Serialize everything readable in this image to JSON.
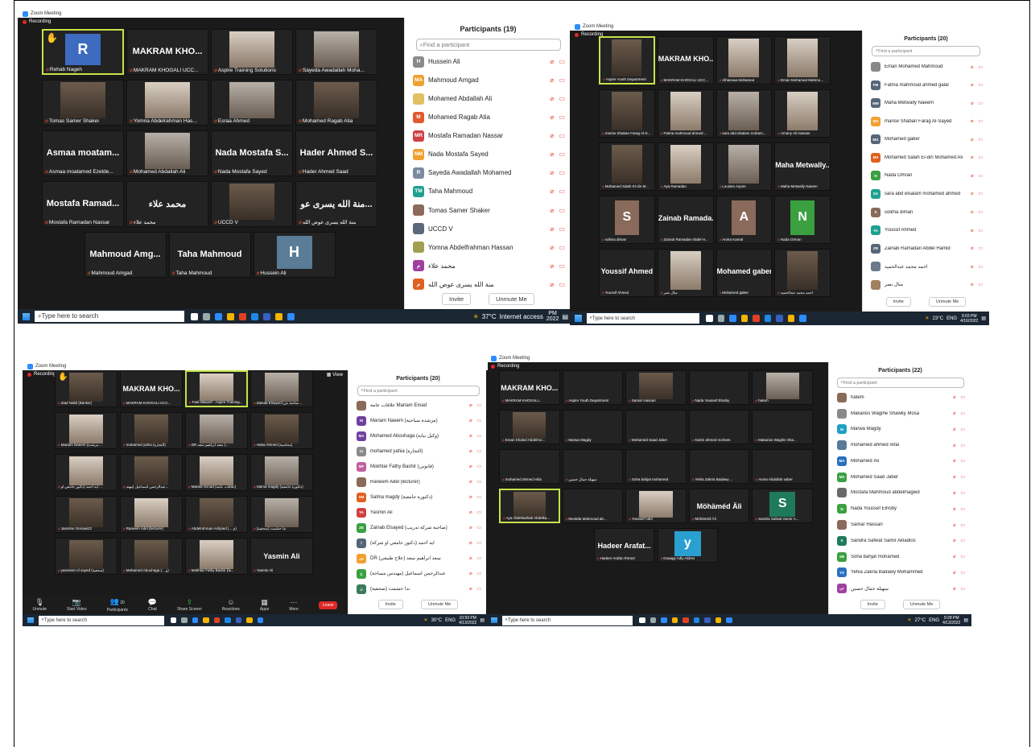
{
  "shots": [
    {
      "title": "Zoom Meeting",
      "recording": "Recording",
      "tiles": [
        {
          "label": "Rehab Nageh",
          "avatar": "R",
          "avatar_color": "#3d6bbf",
          "active": true,
          "raise": true
        },
        {
          "label": "MAKRAM KHOGALI UCC...",
          "big": "MAKRAM KHO..."
        },
        {
          "label": "Aspire Training Solutions",
          "video": "c"
        },
        {
          "label": "Sayeda Awadallah Moha...",
          "video": "b"
        },
        {
          "label": "Tomas Samer Shaker",
          "video": "a"
        },
        {
          "label": "Yomna Abdelrahman Has...",
          "video": "c"
        },
        {
          "label": "Esraa Ahmed",
          "video": "b"
        },
        {
          "label": "Mohamed Ragab Atia",
          "video": "a"
        },
        {
          "label": "Asmaa moatamed Ezelde...",
          "big": "Asmaa moatam..."
        },
        {
          "label": "Mohamed Abdallah Ali",
          "video": "b"
        },
        {
          "label": "Nada Mostafa Sayed",
          "big": "Nada Mostafa S..."
        },
        {
          "label": "Hader Ahmed Saad",
          "big": "Hader Ahmed S..."
        },
        {
          "label": "Mostafa Ramadan Nassar",
          "big": "Mostafa Ramad..."
        },
        {
          "label": "محمد علاء",
          "big": "محمد علاء"
        },
        {
          "label": "UCCD V",
          "video": "a"
        },
        {
          "label": "منة الله يسرى عوض الله",
          "big": "منة الله يسرى عو..."
        },
        {
          "label": "Mahmoud Amgad",
          "big": "Mahmoud Amg..."
        },
        {
          "label": "Taha Mahmoud",
          "big": "Taha Mahmoud"
        },
        {
          "label": "Hussein Ali",
          "avatar": "H",
          "avatar_color": "#5a7c96"
        }
      ],
      "panel_title": "Participants (19)",
      "search": "Find a participant",
      "participants": [
        {
          "av": "H",
          "color": "#8a8a8a",
          "name": "Hussein Ali"
        },
        {
          "av": "MA",
          "color": "#f0a030",
          "name": "Mahmoud Amgad"
        },
        {
          "av": "",
          "color": "#e0c060",
          "name": "Mohamed Abdallah Ali"
        },
        {
          "av": "M",
          "color": "#e05a30",
          "name": "Mohamed Ragab Atia"
        },
        {
          "av": "MR",
          "color": "#d04040",
          "name": "Mostafa Ramadan Nassar"
        },
        {
          "av": "NM",
          "color": "#f0a030",
          "name": "Nada Mostafa Sayed"
        },
        {
          "av": "R",
          "color": "#7a8aa0",
          "name": "Sayeda Awadallah Mohamed"
        },
        {
          "av": "TM",
          "color": "#20a090",
          "name": "Taha Mahmoud"
        },
        {
          "av": "",
          "color": "#8a6a5a",
          "name": "Tomas Samer Shaker"
        },
        {
          "av": "",
          "color": "#5a6a7a",
          "name": "UCCD V"
        },
        {
          "av": "",
          "color": "#a0a050",
          "name": "Yomna Abdelfrahman Hassan"
        },
        {
          "av": "م",
          "color": "#a040a0",
          "name": "محمد علاء"
        },
        {
          "av": "م",
          "color": "#e06020",
          "name": "منة الله يسرى عوض الله"
        }
      ],
      "invite": "Invite",
      "unmute": "Unmute Me",
      "taskbar": {
        "search": "Type here to search",
        "temp": "37°C",
        "time": "PM",
        "date": "2022",
        "note": "Internet access"
      }
    },
    {
      "title": "Zoom Meeting",
      "recording": "Recording",
      "tiles": [
        {
          "label": "Aspire Youth Department",
          "video": "a",
          "active": true
        },
        {
          "label": "MAKRAM KHOGALI UCC...",
          "big": "MAKRAM KHO..."
        },
        {
          "label": "Alhasnaa Mohamed",
          "video": "c"
        },
        {
          "label": "Eman Mohamed Mahmo...",
          "video": "c"
        },
        {
          "label": "marise Shaban Farag Al-S...",
          "video": "d"
        },
        {
          "label": "Fatma mahmoud ahmed ...",
          "video": "c"
        },
        {
          "label": "sara abd elsalam moham...",
          "video": "b"
        },
        {
          "label": "Amany Ali Hassan",
          "video": "c"
        },
        {
          "label": "Mohamed Salah El-din M...",
          "video": "a"
        },
        {
          "label": "Aya Ramadan",
          "video": "c"
        },
        {
          "label": "Lousien Aspire",
          "video": "b"
        },
        {
          "label": "Maha Metwally Naeem",
          "big": "Maha Metwally..."
        },
        {
          "label": "solima diman",
          "avatar": "S",
          "avatar_color": "#8a6a5a"
        },
        {
          "label": "Zainab Ramadan Abdel H...",
          "big": "Zainab Ramada..."
        },
        {
          "label": "Amira Kamal",
          "avatar": "A",
          "avatar_color": "#8a6a5a"
        },
        {
          "label": "Nada Omran",
          "avatar": "N",
          "avatar_color": "#3aa040"
        },
        {
          "label": "Youssif Ahmed",
          "big": "Youssif Ahmed"
        },
        {
          "label": "منال نصر",
          "video": "c"
        },
        {
          "label": "Mohamed gaber",
          "big": "Mohamed gaber"
        },
        {
          "label": "احمد محمد عبدالحميد",
          "video": "a"
        }
      ],
      "panel_title": "Participants (20)",
      "search": "Find a participant",
      "participants": [
        {
          "av": "",
          "color": "#888",
          "name": "Eman Mohamed Mahmoud"
        },
        {
          "av": "FM",
          "color": "#556677",
          "name": "Fatma mahmoud ahmed galal"
        },
        {
          "av": "MM",
          "color": "#556677",
          "name": "Maha Metwally Naeem"
        },
        {
          "av": "MS",
          "color": "#f0a030",
          "name": "marise Shaban Farag Al-Sayed"
        },
        {
          "av": "MG",
          "color": "#556677",
          "name": "Mohamed gaber"
        },
        {
          "av": "MS",
          "color": "#e06020",
          "name": "Mohamed Salah El-din Mohamed Ali"
        },
        {
          "av": "N",
          "color": "#3aa040",
          "name": "Nada Omran"
        },
        {
          "av": "SA",
          "color": "#20a090",
          "name": "sara abd elsalam mohamed ahmed"
        },
        {
          "av": "S",
          "color": "#8a6a5a",
          "name": "solima diman"
        },
        {
          "av": "YA",
          "color": "#20a090",
          "name": "Youssif Ahmed"
        },
        {
          "av": "ZR",
          "color": "#556677",
          "name": "Zainab Ramadan Abdel Hamid"
        },
        {
          "av": "",
          "color": "#6a7a8a",
          "name": "احمد محمد عبدالحميد"
        },
        {
          "av": "",
          "color": "#a08060",
          "name": "منال نصر"
        }
      ],
      "invite": "Invite",
      "unmute": "Unmute Me",
      "taskbar": {
        "search": "Type here to search",
        "temp": "23°C",
        "time": "9:03 PM",
        "date": "4/16/2022",
        "note": "ENG"
      }
    },
    {
      "title": "Zoom Meeting",
      "recording": "Recording",
      "view": "View",
      "tiles": [
        {
          "label": "Ziad Nabil (Banker)",
          "video": "a",
          "raise": true
        },
        {
          "label": "MAKRAM KHOGALI UCC...",
          "big": "MAKRAM KHO..."
        },
        {
          "label": "Fadi Waseef - Aspire Training...",
          "video": "c",
          "active": true
        },
        {
          "label": "Zainab Elsayed (صاحبة ش...",
          "video": "b"
        },
        {
          "label": "Mariam Naeem (مرشدة ...",
          "video": "c"
        },
        {
          "label": "mohamed yahia (التجارة)",
          "video": "a"
        },
        {
          "label": "DR سعد ابراهيم سعد (...",
          "video": "b"
        },
        {
          "label": "Heba Ahmed (محاسبة)",
          "video": "a"
        },
        {
          "label": "ايه أحمد (دكتور جامعي او ...",
          "video": "c"
        },
        {
          "label": "عبدالرحمن اسماعيل (مهند...",
          "video": "a"
        },
        {
          "label": "Mariam Emad (علاقات عامة)",
          "video": "c"
        },
        {
          "label": "Salma magdy (دكتورة جامعية)",
          "video": "b"
        },
        {
          "label": "Jasmine Genawi22",
          "video": "a"
        },
        {
          "label": "Raneem Adel (lecturer)",
          "video": "c"
        },
        {
          "label": "Abdelrahman Ashpied (... م)",
          "video": "a"
        },
        {
          "label": "ندا حشمت (صحفية)",
          "video": "b"
        },
        {
          "label": "yasmeen el sayed (صحفية)",
          "video": "a"
        },
        {
          "label": "Mohamed Abouhaga (... و)",
          "video": "a"
        },
        {
          "label": "Mokhtar Fathy Bashir (قا...",
          "video": "c"
        },
        {
          "label": "Yasmin Ali",
          "big": "Yasmin Ali"
        }
      ],
      "controls": [
        "Unmute",
        "Start Video",
        "Participants",
        "Chat",
        "Share Screen",
        "Reactions",
        "Apps",
        "More"
      ],
      "participant_count": "20",
      "leave": "Leave",
      "panel_title": "Participants (20)",
      "search": "Find a participant",
      "participants": [
        {
          "av": "",
          "color": "#8a6a5a",
          "name": "علاقات عامة Mariam Emad"
        },
        {
          "av": "M",
          "color": "#7040a0",
          "name": "Mariam Naeem (مرشدة سياحية)"
        },
        {
          "av": "MA",
          "color": "#7040a0",
          "name": "Mohamed Abouhaga (وكيل نيابة)"
        },
        {
          "av": "m",
          "color": "#8a8a8a",
          "name": "mohamed yahia (التجارة)"
        },
        {
          "av": "MF",
          "color": "#c060a0",
          "name": "Mokhtar Fathy Bashir (قانوني)"
        },
        {
          "av": "",
          "color": "#8a6a5a",
          "name": "Raneem Adel (lecturer)"
        },
        {
          "av": "SM",
          "color": "#e06020",
          "name": "Salma magdy (دكتورة جامعية)"
        },
        {
          "av": "YA",
          "color": "#d04040",
          "name": "Yasmin Ali"
        },
        {
          "av": "ZE",
          "color": "#3aa040",
          "name": "Zainab Elsayed (صاحبة شركة تدريب)"
        },
        {
          "av": "ا",
          "color": "#556677",
          "name": "ايه أحمد (دكتور جامعي او شركة)"
        },
        {
          "av": "س",
          "color": "#f0a030",
          "name": "DR سعد ابراهيم سعد (علاج طبيعي)"
        },
        {
          "av": "ع",
          "color": "#3aa040",
          "name": "عبدالرحمن اسماعيل (مهندس مساحة)"
        },
        {
          "av": "ن",
          "color": "#3a7a5a",
          "name": "ندا حشمت (صحفية)"
        }
      ],
      "invite": "Invite",
      "unmute": "Unmute Me",
      "taskbar": {
        "search": "Type here to search",
        "temp": "30°C",
        "time": "10:59 PM",
        "date": "4/13/2022",
        "note": "ENG"
      }
    },
    {
      "title": "Zoom Meeting",
      "recording": "Recording",
      "tiles": [
        {
          "label": "MAKRAM KHOGALI...",
          "big": "MAKRAM KHO..."
        },
        {
          "label": "Aspire Youth Department",
          "big": ""
        },
        {
          "label": "Samar Hassan",
          "video": "a"
        },
        {
          "label": "Nada Youssef Elnoby",
          "big": ""
        },
        {
          "label": "hatem",
          "video": "b"
        },
        {
          "label": "Eman Khaled Abdelmo...",
          "video": "a"
        },
        {
          "label": "Marwa Magdy",
          "big": ""
        },
        {
          "label": "Mohamed Saad Jaber",
          "big": ""
        },
        {
          "label": "Karim ahmed mohsen",
          "big": ""
        },
        {
          "label": "Makarios Wagihe Sha...",
          "big": ""
        },
        {
          "label": "mohamed ahmed refai",
          "big": ""
        },
        {
          "label": "سهيلة جمال حسين",
          "big": ""
        },
        {
          "label": "Soha bahjat mohamed",
          "big": ""
        },
        {
          "label": "Yehia Zakria Badawy ...",
          "big": ""
        },
        {
          "label": "Amira Abdullah saber",
          "big": ""
        },
        {
          "label": "Aya Abdelwahab Abdelka...",
          "video": "a",
          "active": true
        },
        {
          "label": "Mostafa Mahmoud ab...",
          "big": ""
        },
        {
          "label": "Youssef Adel",
          "video": "c"
        },
        {
          "label": "Möhäméd Äli",
          "big": "Möhäméd Äli"
        },
        {
          "label": "Sandra Safwat Samir A...",
          "avatar": "S",
          "avatar_color": "#1e7a5a"
        },
        {
          "label": "Hadeer Arafat Ahmed",
          "big": "Hadeer Arafat..."
        },
        {
          "label": "Doaagy Adly Aldres",
          "avatar": "y",
          "avatar_color": "#2aa0d0"
        }
      ],
      "panel_title": "Participants (22)",
      "search": "Find a participant",
      "participants": [
        {
          "av": "",
          "color": "#8a6a5a",
          "name": "hatem"
        },
        {
          "av": "",
          "color": "#8a8a8a",
          "name": "Makarios Wagihe Shawky Mosa"
        },
        {
          "av": "M",
          "color": "#20a0c0",
          "name": "Marwa Magdy"
        },
        {
          "av": "",
          "color": "#5a7a9a",
          "name": "mohamed ahmed refai"
        },
        {
          "av": "MA",
          "color": "#2a70c0",
          "name": "Möhäméd Äli"
        },
        {
          "av": "MS",
          "color": "#3aa040",
          "name": "Mohamed Saad Jaber"
        },
        {
          "av": "",
          "color": "#6a6a6a",
          "name": "Mostafa Mahmoud abdelmageid"
        },
        {
          "av": "N",
          "color": "#3aa040",
          "name": "Nada Youssef Elnoby"
        },
        {
          "av": "",
          "color": "#8a6a5a",
          "name": "Samar Hassan"
        },
        {
          "av": "S",
          "color": "#1e7a5a",
          "name": "Sandra Safwat Samir Akladios"
        },
        {
          "av": "SB",
          "color": "#3aa040",
          "name": "Soha bahjat mohamed"
        },
        {
          "av": "YZ",
          "color": "#2a70c0",
          "name": "Yehia Zakria Badawy Mohammed"
        },
        {
          "av": "س",
          "color": "#a040a0",
          "name": "سهيلة جمال حسين"
        }
      ],
      "invite": "Invite",
      "unmute": "Unmute Me",
      "taskbar": {
        "search": "Type here to search",
        "temp": "27°C",
        "time": "9:28 PM",
        "date": "4/13/2022",
        "note": "ENG"
      }
    }
  ]
}
